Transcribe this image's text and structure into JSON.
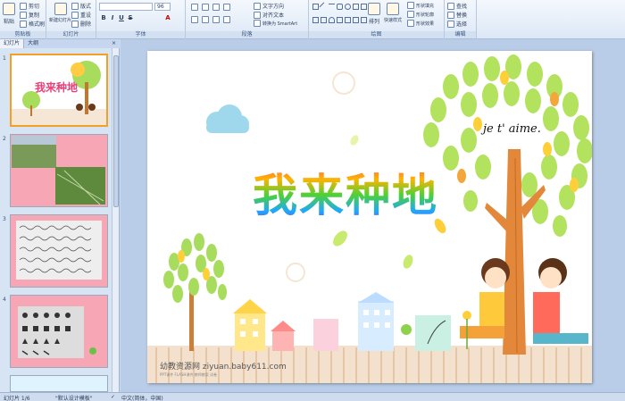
{
  "ribbon": {
    "clipboard": {
      "label": "剪贴板",
      "paste": "粘贴",
      "cut": "剪切",
      "copy": "复制",
      "format_painter": "格式刷"
    },
    "slides": {
      "label": "幻灯片",
      "new_slide": "新建幻灯片",
      "layout": "版式",
      "reset": "重设",
      "delete": "删除"
    },
    "font": {
      "label": "字体",
      "font_size": "96"
    },
    "paragraph": {
      "label": "段落",
      "text_direction": "文字方向",
      "align_text": "对齐文本",
      "smartart": "转换为 SmartArt"
    },
    "drawing": {
      "label": "绘图",
      "arrange": "排列",
      "quick_styles": "快速样式",
      "shape_fill": "形状填充",
      "shape_outline": "形状轮廓",
      "shape_effects": "形状效果"
    },
    "editing": {
      "label": "编辑",
      "find": "查找",
      "replace": "替换",
      "select": "选择"
    }
  },
  "pane": {
    "tabs": [
      "幻灯片",
      "大纲"
    ],
    "slide_numbers": [
      "1",
      "2",
      "3",
      "4"
    ]
  },
  "slide": {
    "title": "我来种地",
    "tree_text": "je t' aime.",
    "watermark": "幼教资源网 ziyuan.baby611.com",
    "watermark_sub": "PPT课件 FLASH课件 教师教案 试卷"
  },
  "status": {
    "slide_count": "幻灯片 1/6",
    "theme": "\"默认设计模板\"",
    "language": "中文(简体，中国)"
  },
  "colors": {
    "selection": "#f2a028",
    "ribbon_bg": "#dde8f6",
    "canvas_bg": "#b9cde8",
    "thumb_pink": "#f7a6b6"
  }
}
